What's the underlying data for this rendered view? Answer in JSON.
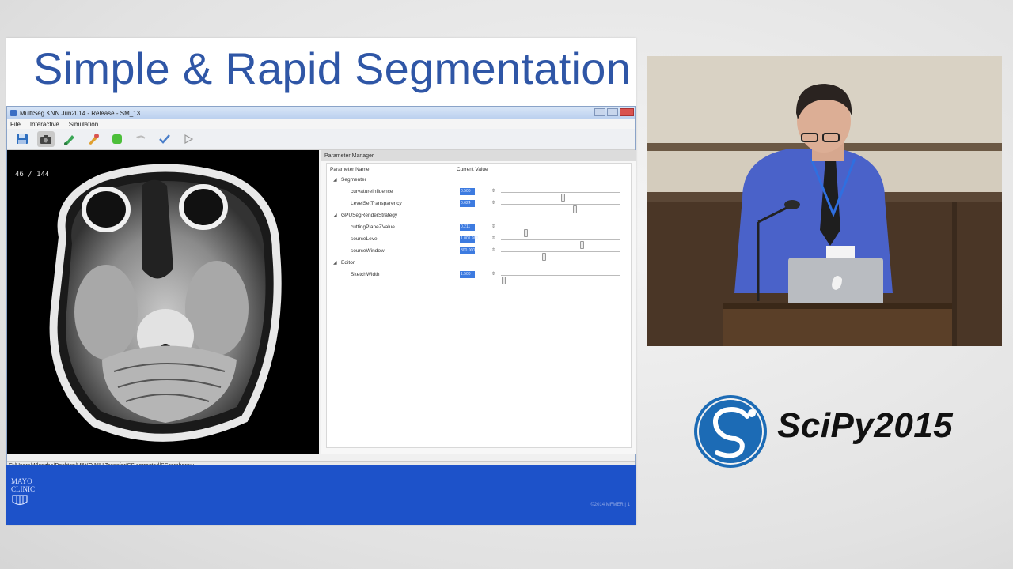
{
  "slide": {
    "title": "Simple & Rapid Segmentation",
    "footer_org": "MAYO CLINIC",
    "footer_copyright": "©2014 MFMER | 1"
  },
  "app": {
    "window_title": "MultiSeg KNN Jun2014 - Release - SM_13",
    "menu": [
      "File",
      "Interactive",
      "Simulation"
    ],
    "toolbar_icons": [
      "save-icon",
      "camera-icon",
      "brush-icon",
      "paint-icon",
      "green-app-icon",
      "undo-icon",
      "check-icon",
      "play-icon"
    ],
    "slice_counter": "46 / 144",
    "status_path": "C:/Users/Wlenzhe/Desktop/MAYO NIH Transfer/SS corrected/SScomhdraw"
  },
  "parameter_manager": {
    "title": "Parameter Manager",
    "col_name": "Parameter Name",
    "col_value": "Current Value",
    "groups": [
      {
        "name": "Segmenter",
        "params": [
          {
            "name": "curvatureInfluence",
            "value": "0.500",
            "slider": 0.52
          },
          {
            "name": "LevelSetTransparency",
            "value": "0.624",
            "slider": 0.62
          }
        ]
      },
      {
        "name": "GPUSegRenderStrategy",
        "params": [
          {
            "name": "cuttingPlaneZValue",
            "value": "0.211",
            "slider": 0.21
          },
          {
            "name": "sourceLevel",
            "value": "1.001.960",
            "slider": 0.68
          },
          {
            "name": "sourceWindow",
            "value": "800.000",
            "slider": 0.36
          }
        ]
      },
      {
        "name": "Editor",
        "params": [
          {
            "name": "SketchWidth",
            "value": "1.500",
            "slider": 0.02
          }
        ]
      }
    ]
  },
  "branding": {
    "scipy_text": "SciPy2015",
    "scipy_color": "#1c6bb5"
  }
}
